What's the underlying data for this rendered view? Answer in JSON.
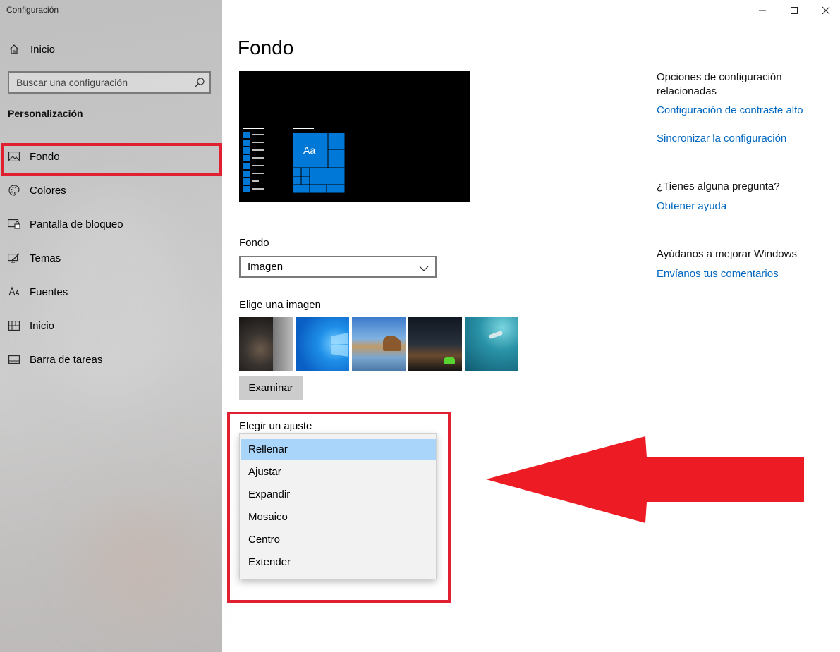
{
  "window": {
    "title": "Configuración"
  },
  "sidebar": {
    "home_label": "Inicio",
    "search_placeholder": "Buscar una configuración",
    "section_title": "Personalización",
    "items": [
      {
        "label": "Fondo",
        "icon": "picture-icon"
      },
      {
        "label": "Colores",
        "icon": "palette-icon"
      },
      {
        "label": "Pantalla de bloqueo",
        "icon": "lock-screen-icon"
      },
      {
        "label": "Temas",
        "icon": "themes-icon"
      },
      {
        "label": "Fuentes",
        "icon": "fonts-icon"
      },
      {
        "label": "Inicio",
        "icon": "start-icon"
      },
      {
        "label": "Barra de tareas",
        "icon": "taskbar-icon"
      }
    ],
    "selected_item": "Fondo"
  },
  "main": {
    "title": "Fondo",
    "preview_tile_text": "Aa",
    "background_label": "Fondo",
    "background_value": "Imagen",
    "choose_image_label": "Elige una imagen",
    "browse_button": "Examinar",
    "fit_label": "Elegir un ajuste",
    "fit_options": [
      "Rellenar",
      "Ajustar",
      "Expandir",
      "Mosaico",
      "Centro",
      "Extender"
    ],
    "fit_selected": "Rellenar"
  },
  "related": {
    "heading": "Opciones de configuración relacionadas",
    "links": [
      "Configuración de contraste alto",
      "Sincronizar la configuración"
    ],
    "question_heading": "¿Tienes alguna pregunta?",
    "help_link": "Obtener ayuda",
    "improve_heading": "Ayúdanos a mejorar Windows",
    "feedback_link": "Envíanos tus comentarios"
  },
  "colors": {
    "accent": "#0078d7",
    "link": "#0067c0",
    "annotation_red": "#e02030",
    "selected_option": "#a9d5fb"
  }
}
